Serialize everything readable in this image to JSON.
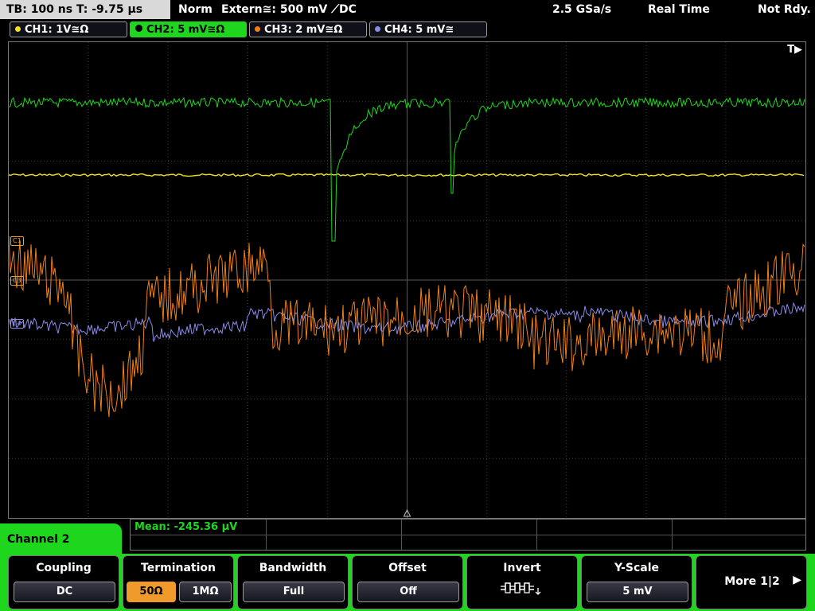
{
  "top_bar": {
    "timebase": "TB: 100 ns   T: -9.75 µs",
    "trigger_mode": "Norm",
    "trigger_source": "Extern≅: 500 mV ⟋DC",
    "sample_rate": "2.5 GSa/s",
    "acq_mode": "Real Time",
    "status": "Not Rdy."
  },
  "channels": [
    {
      "label": "CH1: 1V≅Ω",
      "color": "#f0e020"
    },
    {
      "label": "CH2: 5 mV≅Ω",
      "color": "#1ed61e"
    },
    {
      "label": "CH3: 2 mV≅Ω",
      "color": "#ef7f1a"
    },
    {
      "label": "CH4: 5 mV≅",
      "color": "#8a8ae8"
    }
  ],
  "screen": {
    "trigger_marker": "T▶",
    "markers": [
      "C1",
      "C3",
      "C4"
    ]
  },
  "measurement": {
    "mean": "Mean: -245.36 µV"
  },
  "menu": {
    "title": "Channel 2",
    "softkeys": {
      "coupling": {
        "title": "Coupling",
        "value": "DC"
      },
      "termination": {
        "title": "Termination",
        "opt_a": "50Ω",
        "opt_b": "1MΩ"
      },
      "bandwidth": {
        "title": "Bandwidth",
        "value": "Full"
      },
      "offset": {
        "title": "Offset",
        "value": "Off"
      },
      "invert": {
        "title": "Invert",
        "icon": "square-wave-invert-icon"
      },
      "yscale": {
        "title": "Y-Scale",
        "value": "5 mV"
      },
      "more": {
        "label": "More 1|2",
        "icon": "arrow-right-icon"
      }
    }
  },
  "accent_color": "#1ed61e"
}
